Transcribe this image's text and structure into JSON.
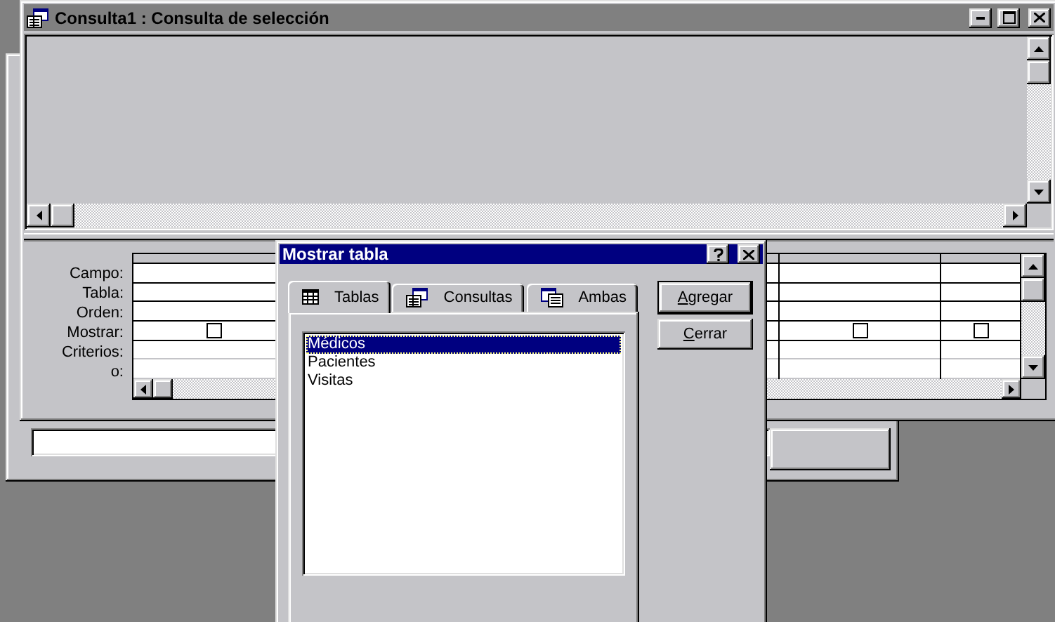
{
  "main_window": {
    "title": "Consulta1 : Consulta de selección",
    "design_grid": {
      "row_labels": [
        "Campo:",
        "Tabla:",
        "Orden:",
        "Mostrar:",
        "Criterios:",
        "o:"
      ],
      "columns": [
        {
          "show_checked": false
        },
        {
          "show_checked": false
        },
        {
          "show_checked": false
        }
      ]
    }
  },
  "dialog": {
    "title": "Mostrar tabla",
    "tabs": [
      {
        "label": "Tablas",
        "kind": "tables",
        "selected": true
      },
      {
        "label": "Consultas",
        "kind": "queries",
        "selected": false
      },
      {
        "label": "Ambas",
        "kind": "both",
        "selected": false
      }
    ],
    "list_items": [
      {
        "label": "Médicos",
        "selected": true
      },
      {
        "label": "Pacientes",
        "selected": false
      },
      {
        "label": "Visitas",
        "selected": false
      }
    ],
    "buttons": [
      {
        "label": "Agregar",
        "default": true
      },
      {
        "label": "Cerrar",
        "default": false
      }
    ]
  }
}
